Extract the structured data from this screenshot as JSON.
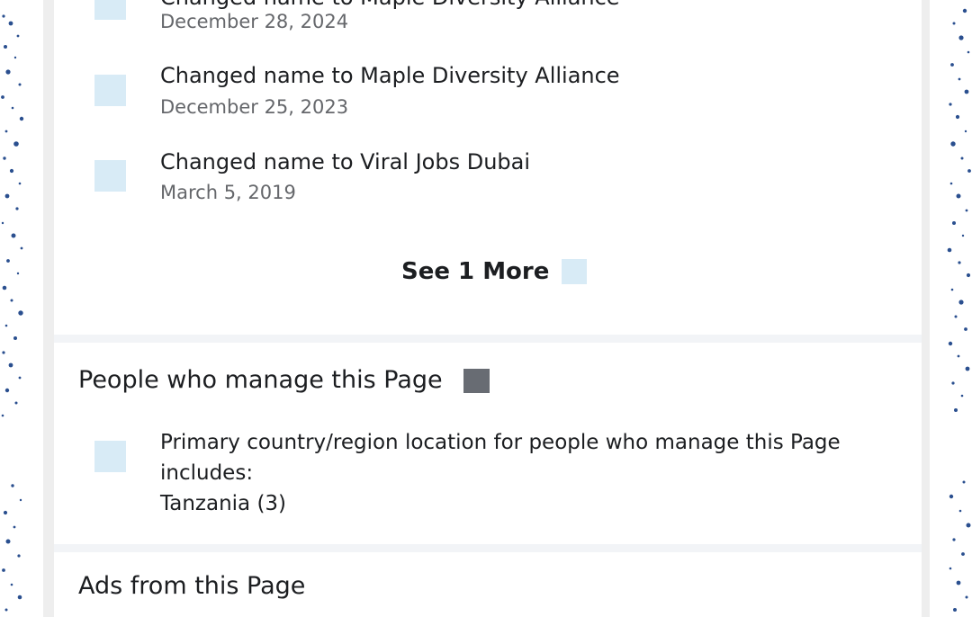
{
  "page_history": {
    "entries": [
      {
        "title": "Changed name to Maple Diversity Alliance",
        "date": "December 28, 2024"
      },
      {
        "title": "Changed name to Maple Diversity Alliance",
        "date": "December 25, 2023"
      },
      {
        "title": "Changed name to Viral Jobs Dubai",
        "date": "March 5, 2019"
      }
    ],
    "see_more_label": "See 1 More"
  },
  "managers": {
    "heading": "People who manage this Page",
    "location_label": "Primary country/region location for people who manage this Page includes:",
    "location_value": "Tanzania (3)"
  },
  "ads": {
    "heading": "Ads from this Page"
  },
  "colors": {
    "page_background": "#ffffff",
    "card_background": "#f2f4f7",
    "icon_placeholder": "#d8ebf6",
    "info_icon": "#686c73",
    "border_pattern": "#2a4f8f",
    "primary_text": "#1c1e21",
    "secondary_text": "#65676b"
  },
  "icons": {
    "entry": "name-change-icon",
    "see_more": "chevron-down-icon",
    "managers_info": "info-icon",
    "location": "location-pin-icon"
  }
}
